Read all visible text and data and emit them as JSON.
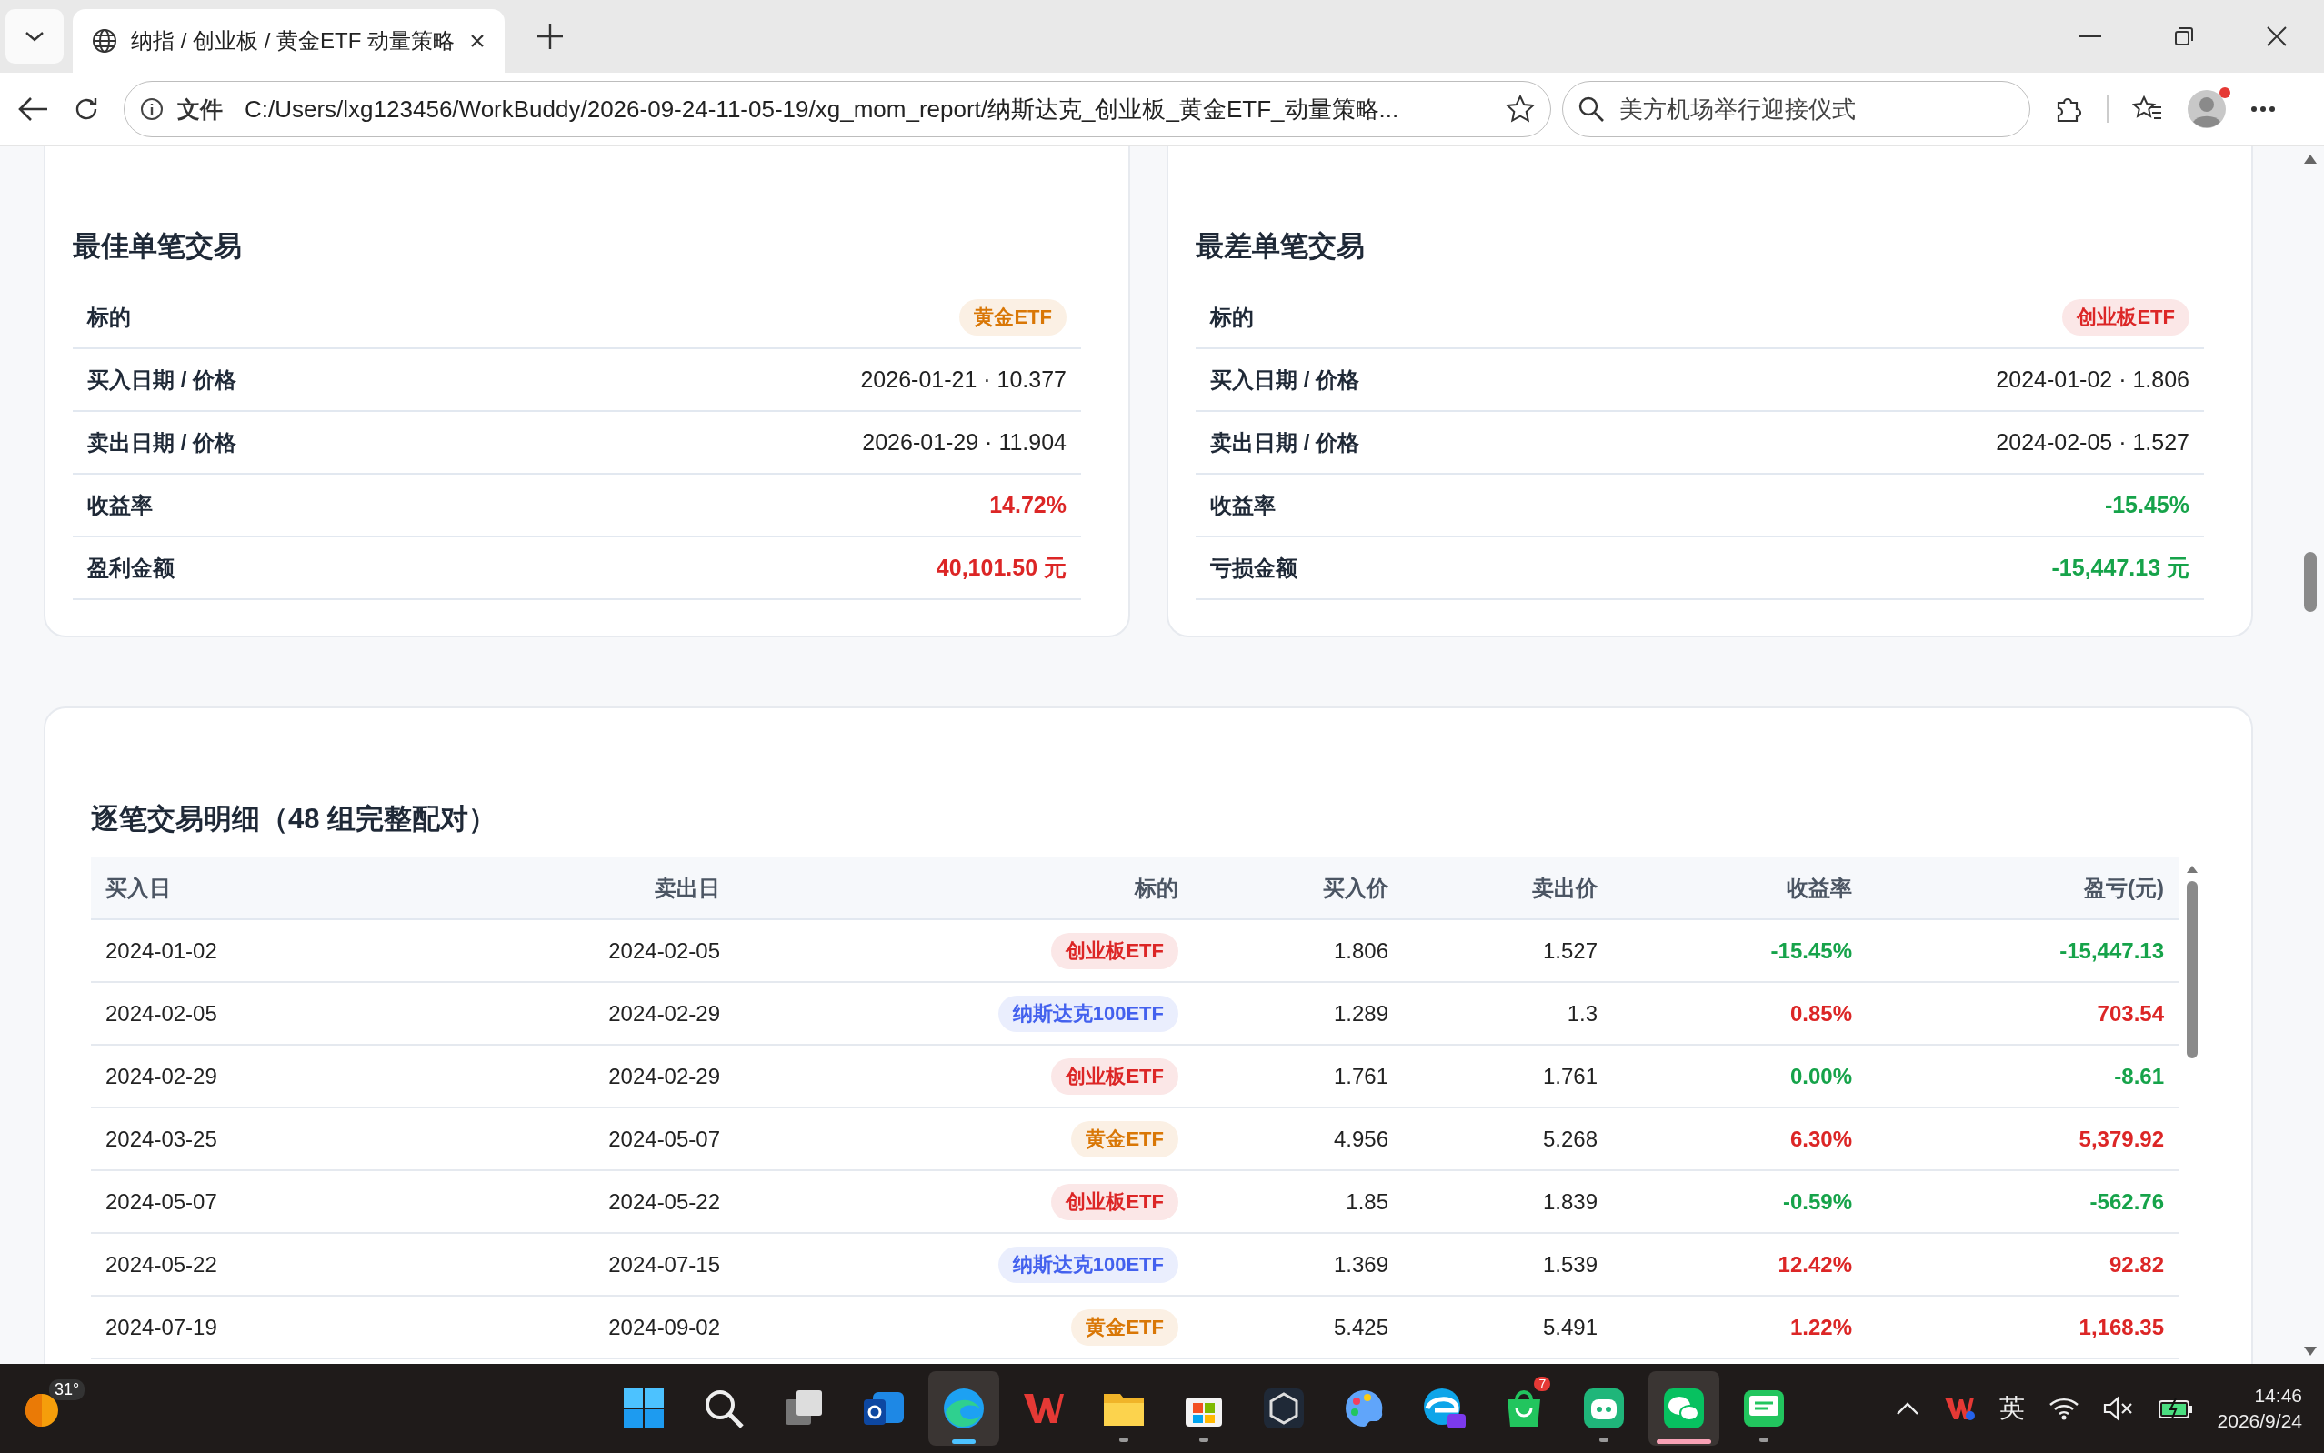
{
  "browser": {
    "tab": {
      "title": "纳指 / 创业板 / 黄金ETF 动量策略"
    },
    "address": {
      "scheme": "文件",
      "url": "C:/Users/lxg123456/WorkBuddy/2026-09-24-11-05-19/xg_mom_report/纳斯达克_创业板_黄金ETF_动量策略..."
    },
    "search": {
      "value": "美方机场举行迎接仪式"
    }
  },
  "cards": [
    {
      "title": "最佳单笔交易",
      "rows": [
        {
          "label": "标的",
          "value": "黄金ETF",
          "kind": "tag",
          "color": "#d97706"
        },
        {
          "label": "买入日期 / 价格",
          "value": "2026-01-21 · 10.377",
          "kind": "text"
        },
        {
          "label": "卖出日期 / 价格",
          "value": "2026-01-29 · 11.904",
          "kind": "text"
        },
        {
          "label": "收益率",
          "value": "14.72%",
          "kind": "colored",
          "color": "#dc2626"
        },
        {
          "label": "盈利金额",
          "value": "40,101.50 元",
          "kind": "colored",
          "color": "#dc2626"
        }
      ]
    },
    {
      "title": "最差单笔交易",
      "rows": [
        {
          "label": "标的",
          "value": "创业板ETF",
          "kind": "tag",
          "color": "#dc2626"
        },
        {
          "label": "买入日期 / 价格",
          "value": "2024-01-02 · 1.806",
          "kind": "text"
        },
        {
          "label": "卖出日期 / 价格",
          "value": "2024-02-05 · 1.527",
          "kind": "text"
        },
        {
          "label": "收益率",
          "value": "-15.45%",
          "kind": "colored",
          "color": "#16a34a"
        },
        {
          "label": "亏损金额",
          "value": "-15,447.13 元",
          "kind": "colored",
          "color": "#16a34a"
        }
      ]
    }
  ],
  "trades": {
    "title": "逐笔交易明细（48 组完整配对）",
    "columns": [
      "买入日",
      "卖出日",
      "标的",
      "买入价",
      "卖出价",
      "收益率",
      "盈亏(元)"
    ],
    "rows": [
      {
        "buy_date": "2024-01-02",
        "sell_date": "2024-02-05",
        "asset": {
          "label": "创业板ETF",
          "color": "#dc2626"
        },
        "buy_price": "1.806",
        "sell_price": "1.527",
        "return": "-15.45%",
        "pnl": "-15,447.13",
        "color": "#16a34a"
      },
      {
        "buy_date": "2024-02-05",
        "sell_date": "2024-02-29",
        "asset": {
          "label": "纳斯达克100ETF",
          "color": "#4361ee"
        },
        "buy_price": "1.289",
        "sell_price": "1.3",
        "return": "0.85%",
        "pnl": "703.54",
        "color": "#dc2626"
      },
      {
        "buy_date": "2024-02-29",
        "sell_date": "2024-02-29",
        "asset": {
          "label": "创业板ETF",
          "color": "#dc2626"
        },
        "buy_price": "1.761",
        "sell_price": "1.761",
        "return": "0.00%",
        "pnl": "-8.61",
        "color": "#16a34a"
      },
      {
        "buy_date": "2024-03-25",
        "sell_date": "2024-05-07",
        "asset": {
          "label": "黄金ETF",
          "color": "#d97706"
        },
        "buy_price": "4.956",
        "sell_price": "5.268",
        "return": "6.30%",
        "pnl": "5,379.92",
        "color": "#dc2626"
      },
      {
        "buy_date": "2024-05-07",
        "sell_date": "2024-05-22",
        "asset": {
          "label": "创业板ETF",
          "color": "#dc2626"
        },
        "buy_price": "1.85",
        "sell_price": "1.839",
        "return": "-0.59%",
        "pnl": "-562.76",
        "color": "#16a34a"
      },
      {
        "buy_date": "2024-05-22",
        "sell_date": "2024-07-15",
        "asset": {
          "label": "纳斯达克100ETF",
          "color": "#4361ee"
        },
        "buy_price": "1.369",
        "sell_price": "1.539",
        "return": "12.42%",
        "pnl": "92.82",
        "color": "#dc2626"
      },
      {
        "buy_date": "2024-07-19",
        "sell_date": "2024-09-02",
        "asset": {
          "label": "黄金ETF",
          "color": "#d97706"
        },
        "buy_price": "5.425",
        "sell_price": "5.491",
        "return": "1.22%",
        "pnl": "1,168.35",
        "color": "#dc2626"
      }
    ]
  },
  "taskbar": {
    "weather": "31°",
    "apps": [
      {
        "kind": "start",
        "selected": false,
        "running": false
      },
      {
        "kind": "search",
        "selected": false,
        "running": false
      },
      {
        "kind": "taskview",
        "selected": false,
        "running": false
      },
      {
        "kind": "mail",
        "selected": false,
        "running": false
      },
      {
        "kind": "browser",
        "selected": true,
        "running": true
      },
      {
        "kind": "office",
        "selected": false,
        "running": false
      },
      {
        "kind": "folder",
        "selected": false,
        "running": true
      },
      {
        "kind": "store",
        "selected": false,
        "running": true
      },
      {
        "kind": "cube",
        "selected": false,
        "running": false
      },
      {
        "kind": "palette",
        "selected": false,
        "running": false
      },
      {
        "kind": "browser-ai",
        "selected": false,
        "running": false
      },
      {
        "kind": "bag",
        "selected": false,
        "running": false,
        "badge": "7"
      },
      {
        "kind": "robot",
        "selected": false,
        "running": true
      },
      {
        "kind": "chat",
        "selected": true,
        "running": true
      },
      {
        "kind": "message",
        "selected": false,
        "running": true
      }
    ],
    "ime": "英",
    "time": "14:46",
    "date": "2026/9/24"
  }
}
